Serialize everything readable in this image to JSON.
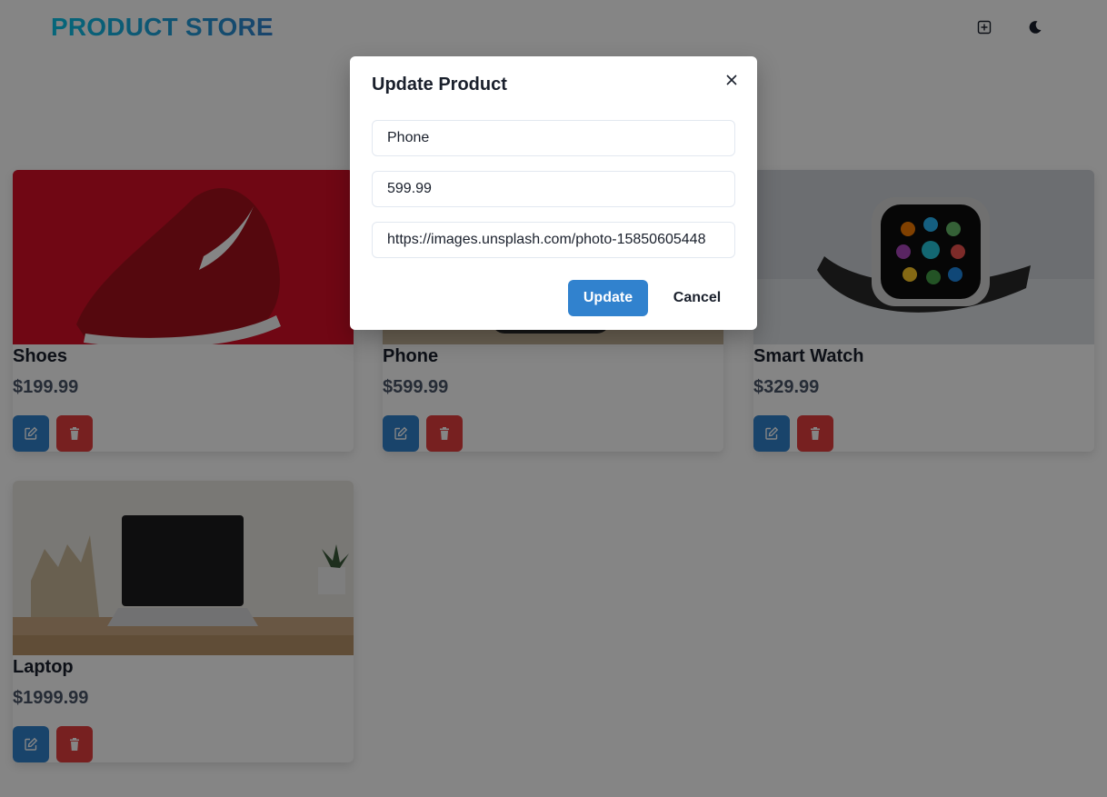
{
  "navbar": {
    "brand": "PRODUCT STORE",
    "add_icon": "plus-square-icon",
    "mode_icon": "moon-icon"
  },
  "products": [
    {
      "name": "Shoes",
      "price": "$199.99",
      "image": "red-sneaker-photo"
    },
    {
      "name": "Phone",
      "price": "$599.99",
      "image": "phone-photo"
    },
    {
      "name": "Smart Watch",
      "price": "$329.99",
      "image": "smart-watch-photo"
    },
    {
      "name": "Laptop",
      "price": "$1999.99",
      "image": "laptop-desk-photo"
    }
  ],
  "modal": {
    "title": "Update Product",
    "name_value": "Phone",
    "price_value": "599.99",
    "image_value": "https://images.unsplash.com/photo-15850605448",
    "update_label": "Update",
    "cancel_label": "Cancel"
  },
  "colors": {
    "accent": "#3182ce",
    "danger": "#e53e3e",
    "brand_gradient_start": "#0bc5ea",
    "brand_gradient_end": "#3182ce"
  }
}
